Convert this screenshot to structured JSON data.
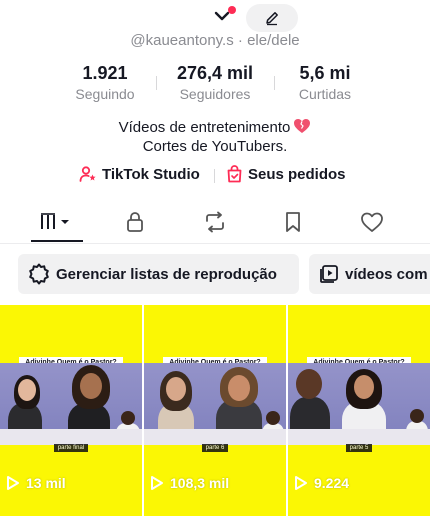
{
  "profile": {
    "handle": "@kaueantony.s",
    "pronouns": "· ele/dele",
    "stats": [
      {
        "value": "1.921",
        "label": "Seguindo"
      },
      {
        "value": "276,4 mil",
        "label": "Seguidores"
      },
      {
        "value": "5,6 mi",
        "label": "Curtidas"
      }
    ],
    "bio_line1": "Vídeos de entretenimento",
    "bio_line2": "Cortes de YouTubers.",
    "links": [
      {
        "label": "TikTok Studio",
        "icon": "person-star-icon"
      },
      {
        "label": "Seus pedidos",
        "icon": "shopping-bag-icon"
      }
    ]
  },
  "tabs": [
    {
      "name": "videos-grid-icon",
      "active": true
    },
    {
      "name": "lock-icon"
    },
    {
      "name": "repost-icon"
    },
    {
      "name": "bookmark-icon"
    },
    {
      "name": "heart-icon"
    }
  ],
  "chips": [
    {
      "label": "Gerenciar listas de reprodução",
      "icon": "gear-icon"
    },
    {
      "label": "vídeos com",
      "icon": "playlist-icon"
    }
  ],
  "videos": [
    {
      "title": "Adivinhe Quem é o Pastor?",
      "part": "parte final",
      "views": "13 mil"
    },
    {
      "title": "Adivinhe Quem é o Pastor?",
      "part": "parte 6",
      "views": "108,3 mil"
    },
    {
      "title": "Adivinhe Quem é o Pastor?",
      "part": "parte 5",
      "views": "9.224"
    }
  ],
  "colors": {
    "accent": "#fe2c55",
    "tile_background": "#fbf704",
    "muted_text": "#8a8b91"
  }
}
